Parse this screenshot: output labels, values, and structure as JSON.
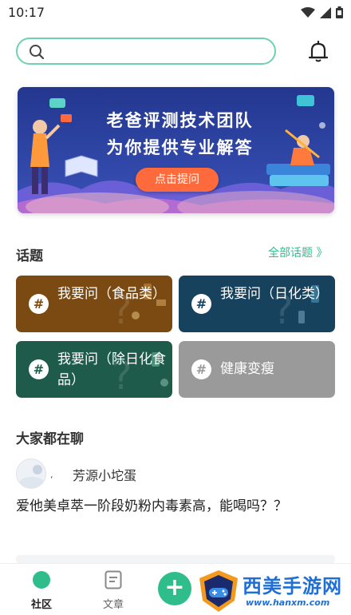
{
  "status_bar": {
    "time": "10:17"
  },
  "search": {
    "value": "",
    "placeholder": ""
  },
  "banner": {
    "line1": "老爸评测技术团队",
    "line2": "为你提供专业解答",
    "button": "点击提问"
  },
  "topics_section": {
    "title": "话题",
    "see_all": "全部话题 》",
    "items": [
      {
        "label": "我要问（食品类）",
        "color": "#7a4a12"
      },
      {
        "label": "我要问（日化类）",
        "color": "#17425e"
      },
      {
        "label": "我要问（除日化食品）",
        "color": "#1e5b4b"
      },
      {
        "label": "健康变瘦",
        "color": "#9a9a9a"
      }
    ]
  },
  "chat_section": {
    "title": "大家都在聊",
    "post": {
      "author_mark": "᷊",
      "author": "芳源小坨蛋",
      "text": "爱他美卓萃一阶段奶粉内毒素高，能喝吗？？"
    }
  },
  "bottom_nav": {
    "community": "社区",
    "articles": "文章"
  },
  "watermark": {
    "title": "西美手游网",
    "url": "www.hanxm.com"
  },
  "colors": {
    "accent": "#2fbd8c",
    "banner_button": "#ff6a3d",
    "banner_bg": "#2d3f9e"
  },
  "icons": [
    "search-icon",
    "bell-icon",
    "hash-icon",
    "community-icon",
    "article-icon",
    "add-icon",
    "wifi-icon",
    "signal-icon",
    "battery-icon"
  ]
}
